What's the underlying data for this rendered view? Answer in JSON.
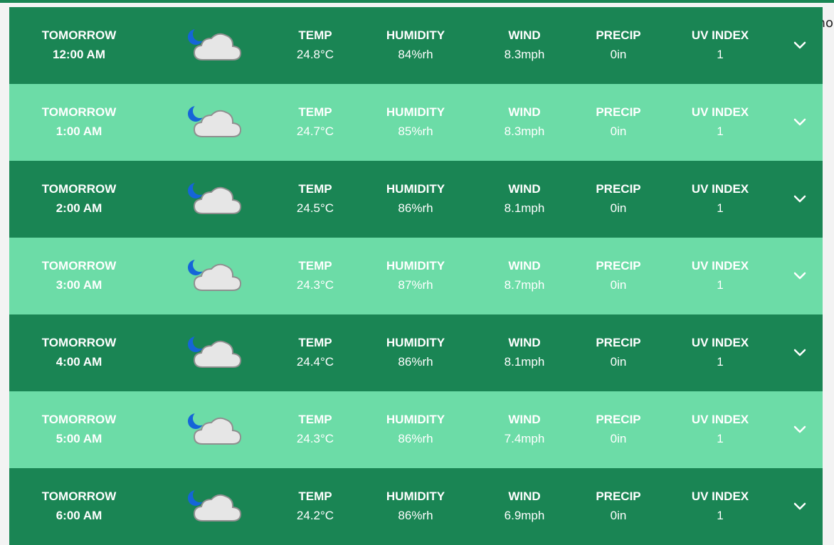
{
  "dark_mode_label": "Dark mo",
  "labels": {
    "temp": "TEMP",
    "humidity": "HUMIDITY",
    "wind": "WIND",
    "precip": "PRECIP",
    "uv": "UV INDEX"
  },
  "rows": [
    {
      "day": "TOMORROW",
      "time": "12:00 AM",
      "temp": "24.8°C",
      "humidity": "84%rh",
      "wind": "8.3mph",
      "precip": "0in",
      "uv": "1",
      "icon": "partly-cloudy-night-icon"
    },
    {
      "day": "TOMORROW",
      "time": "1:00 AM",
      "temp": "24.7°C",
      "humidity": "85%rh",
      "wind": "8.3mph",
      "precip": "0in",
      "uv": "1",
      "icon": "partly-cloudy-night-icon"
    },
    {
      "day": "TOMORROW",
      "time": "2:00 AM",
      "temp": "24.5°C",
      "humidity": "86%rh",
      "wind": "8.1mph",
      "precip": "0in",
      "uv": "1",
      "icon": "partly-cloudy-night-icon"
    },
    {
      "day": "TOMORROW",
      "time": "3:00 AM",
      "temp": "24.3°C",
      "humidity": "87%rh",
      "wind": "8.7mph",
      "precip": "0in",
      "uv": "1",
      "icon": "partly-cloudy-night-icon"
    },
    {
      "day": "TOMORROW",
      "time": "4:00 AM",
      "temp": "24.4°C",
      "humidity": "86%rh",
      "wind": "8.1mph",
      "precip": "0in",
      "uv": "1",
      "icon": "partly-cloudy-night-icon"
    },
    {
      "day": "TOMORROW",
      "time": "5:00 AM",
      "temp": "24.3°C",
      "humidity": "86%rh",
      "wind": "7.4mph",
      "precip": "0in",
      "uv": "1",
      "icon": "partly-cloudy-night-icon"
    },
    {
      "day": "TOMORROW",
      "time": "6:00 AM",
      "temp": "24.2°C",
      "humidity": "86%rh",
      "wind": "6.9mph",
      "precip": "0in",
      "uv": "1",
      "icon": "partly-cloudy-night-icon"
    }
  ],
  "colors": {
    "row_dark": "#1a8554",
    "row_light": "#6cdca7",
    "moon": "#1565d8",
    "cloud": "#e6e6e6"
  }
}
